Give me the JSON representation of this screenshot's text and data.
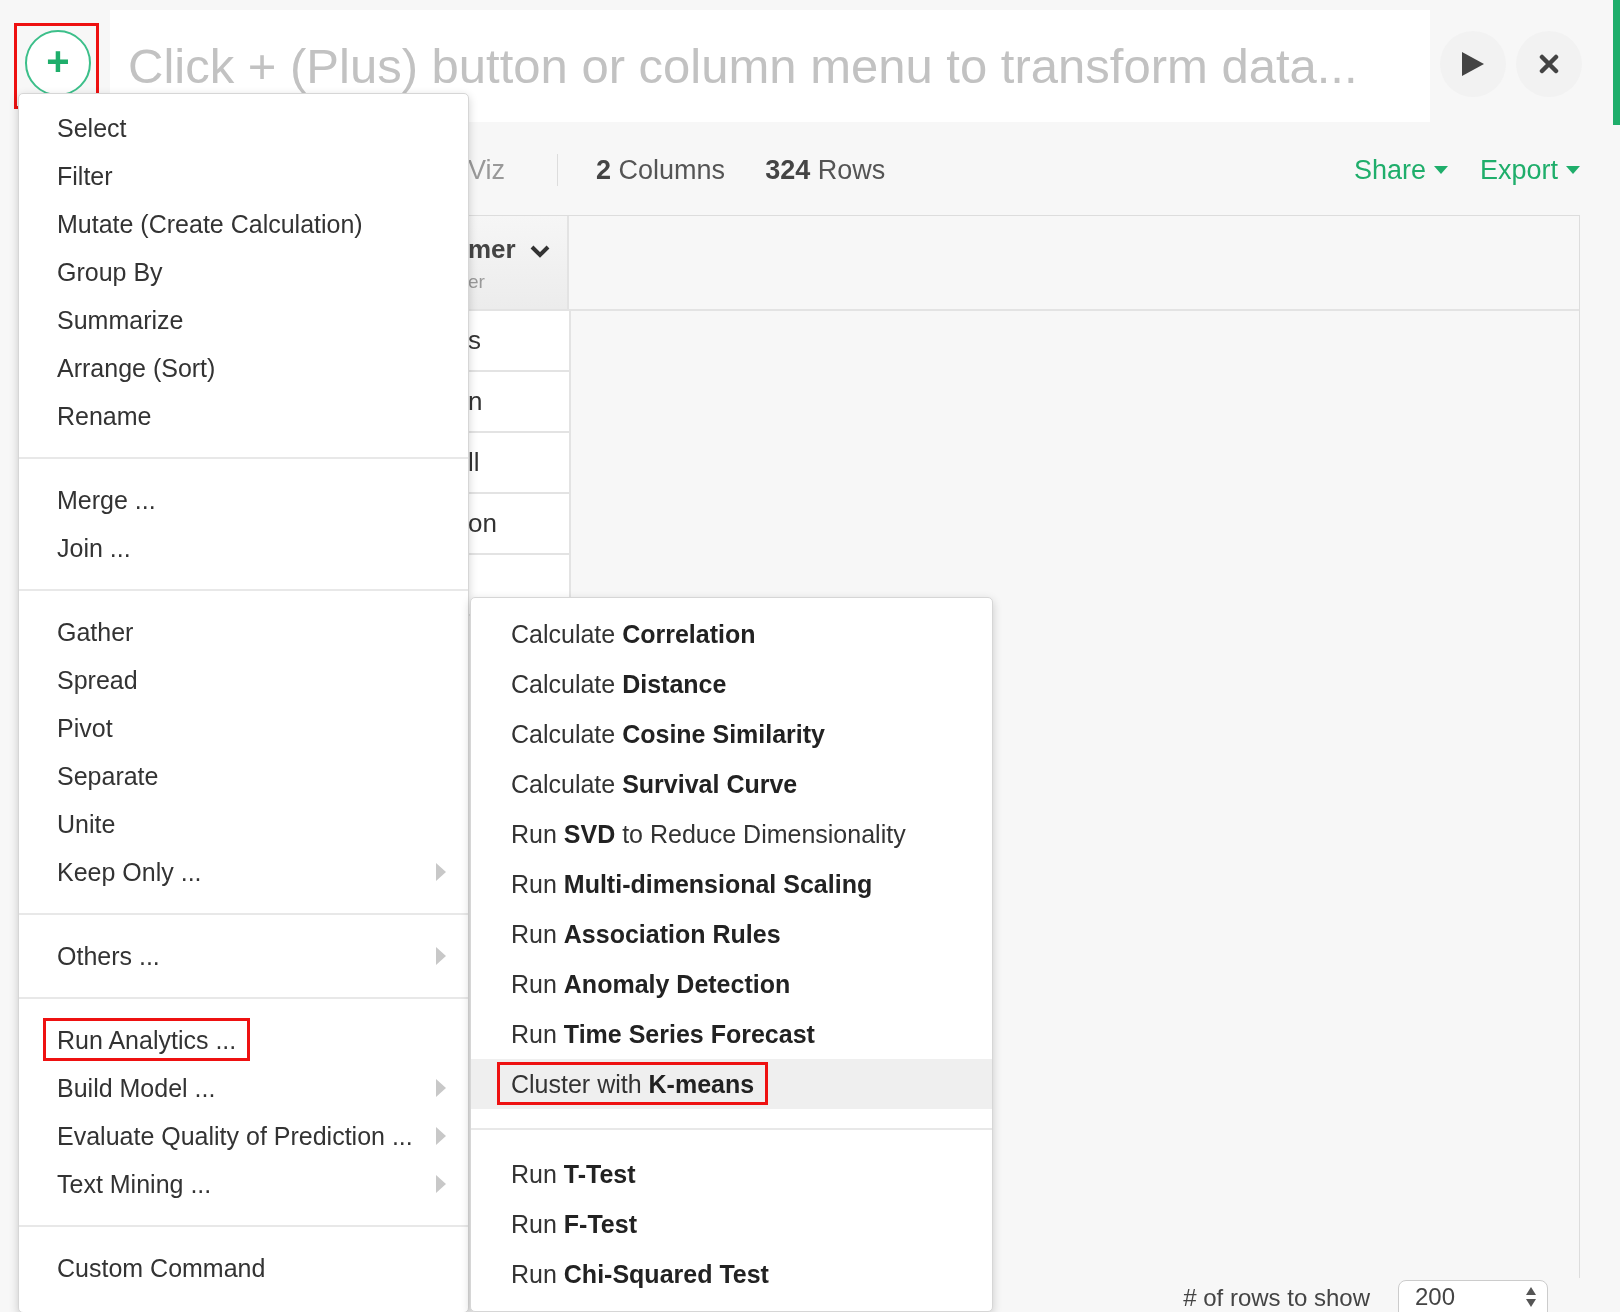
{
  "command_bar": {
    "add_button": {
      "label": "+",
      "annotated": true
    },
    "placeholder": "Click + (Plus) button or column menu to transform data..."
  },
  "toolbar": {
    "tab_fragment": "Viz",
    "columns": {
      "count": "2",
      "label": "Columns"
    },
    "rows": {
      "count": "324",
      "label": "Rows"
    },
    "actions": [
      "Share",
      "Export"
    ]
  },
  "table": {
    "header": {
      "name": "mer",
      "type": "er"
    },
    "cells": [
      "s",
      "n",
      "ll",
      "on"
    ]
  },
  "footer": {
    "label": "# of rows to show",
    "rows_select": "200"
  },
  "menu": {
    "groups": [
      [
        {
          "label": "Select",
          "submenu": false,
          "annotated": false
        },
        {
          "label": "Filter",
          "submenu": false,
          "annotated": false
        },
        {
          "label": "Mutate (Create Calculation)",
          "submenu": false,
          "annotated": false
        },
        {
          "label": "Group By",
          "submenu": false,
          "annotated": false
        },
        {
          "label": "Summarize",
          "submenu": false,
          "annotated": false
        },
        {
          "label": "Arrange (Sort)",
          "submenu": false,
          "annotated": false
        },
        {
          "label": "Rename",
          "submenu": false,
          "annotated": false
        }
      ],
      [
        {
          "label": "Merge ...",
          "submenu": false,
          "annotated": false
        },
        {
          "label": "Join ...",
          "submenu": false,
          "annotated": false
        }
      ],
      [
        {
          "label": "Gather",
          "submenu": false,
          "annotated": false
        },
        {
          "label": "Spread",
          "submenu": false,
          "annotated": false
        },
        {
          "label": "Pivot",
          "submenu": false,
          "annotated": false
        },
        {
          "label": "Separate",
          "submenu": false,
          "annotated": false
        },
        {
          "label": "Unite",
          "submenu": false,
          "annotated": false
        },
        {
          "label": "Keep Only ...",
          "submenu": true,
          "annotated": false
        }
      ],
      [
        {
          "label": "Others ...",
          "submenu": true,
          "annotated": false
        }
      ],
      [
        {
          "label": "Run Analytics ...",
          "submenu": false,
          "annotated": true
        },
        {
          "label": "Build Model ...",
          "submenu": true,
          "annotated": false
        },
        {
          "label": "Evaluate Quality of Prediction ...",
          "submenu": true,
          "annotated": false
        },
        {
          "label": "Text Mining ...",
          "submenu": true,
          "annotated": false
        }
      ],
      [
        {
          "label": "Custom Command",
          "submenu": false,
          "annotated": false
        }
      ]
    ]
  },
  "submenu": {
    "groups": [
      [
        {
          "label": "Calculate **Correlation**",
          "highlighted": false,
          "annotated": false
        },
        {
          "label": "Calculate **Distance**",
          "highlighted": false,
          "annotated": false
        },
        {
          "label": "Calculate **Cosine Similarity**",
          "highlighted": false,
          "annotated": false
        },
        {
          "label": "Calculate **Survival Curve**",
          "highlighted": false,
          "annotated": false
        },
        {
          "label": "Run **SVD** to Reduce Dimensionality",
          "highlighted": false,
          "annotated": false
        },
        {
          "label": "Run **Multi-dimensional Scaling**",
          "highlighted": false,
          "annotated": false
        },
        {
          "label": "Run **Association Rules**",
          "highlighted": false,
          "annotated": false
        },
        {
          "label": "Run **Anomaly Detection**",
          "highlighted": false,
          "annotated": false
        },
        {
          "label": "Run **Time Series Forecast**",
          "highlighted": false,
          "annotated": false
        },
        {
          "label": "Cluster with **K-means**",
          "highlighted": true,
          "annotated": true
        }
      ],
      [
        {
          "label": "Run **T-Test**",
          "highlighted": false,
          "annotated": false
        },
        {
          "label": "Run **F-Test**",
          "highlighted": false,
          "annotated": false
        },
        {
          "label": "Run **Chi-Squared Test**",
          "highlighted": false,
          "annotated": false
        }
      ]
    ]
  }
}
